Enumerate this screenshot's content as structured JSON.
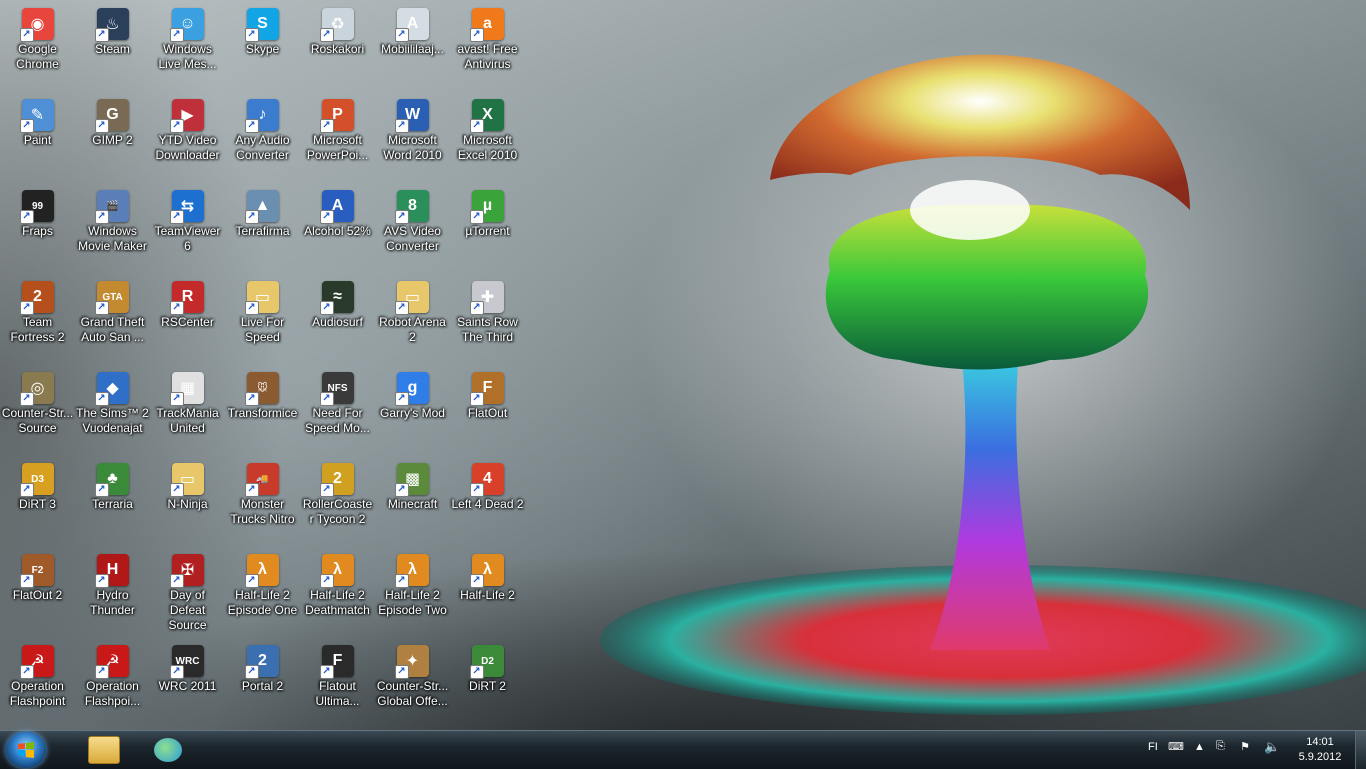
{
  "desktop_icons": [
    {
      "label": "Google Chrome",
      "icon": "chrome-icon",
      "color": "#e8453c",
      "glyph": "◉"
    },
    {
      "label": "Steam",
      "icon": "steam-icon",
      "color": "#2a3f5a",
      "glyph": "♨"
    },
    {
      "label": "Windows Live Mes...",
      "icon": "messenger-icon",
      "color": "#3aa0e0",
      "glyph": "☺"
    },
    {
      "label": "Skype",
      "icon": "skype-icon",
      "color": "#12a5e6",
      "glyph": "S"
    },
    {
      "label": "Roskakori",
      "icon": "recycle-bin-icon",
      "color": "#c9d4dc",
      "glyph": "♻"
    },
    {
      "label": "Mobiililaaj...",
      "icon": "mobile-broadband-icon",
      "color": "#d5dde4",
      "glyph": "A"
    },
    {
      "label": "avast! Free Antivirus",
      "icon": "avast-icon",
      "color": "#f07a1a",
      "glyph": "a"
    },
    {
      "label": "Paint",
      "icon": "paint-icon",
      "color": "#4e8fd6",
      "glyph": "✎"
    },
    {
      "label": "GIMP 2",
      "icon": "gimp-icon",
      "color": "#7b6a53",
      "glyph": "G"
    },
    {
      "label": "YTD Video Downloader",
      "icon": "ytd-icon",
      "color": "#c0303a",
      "glyph": "▶"
    },
    {
      "label": "Any Audio Converter",
      "icon": "audio-converter-icon",
      "color": "#3b7ccf",
      "glyph": "♪"
    },
    {
      "label": "Microsoft PowerPoi...",
      "icon": "powerpoint-icon",
      "color": "#d4502a",
      "glyph": "P"
    },
    {
      "label": "Microsoft Word 2010",
      "icon": "word-icon",
      "color": "#2b5fb4",
      "glyph": "W"
    },
    {
      "label": "Microsoft Excel 2010",
      "icon": "excel-icon",
      "color": "#217346",
      "glyph": "X"
    },
    {
      "label": "Fraps",
      "icon": "fraps-icon",
      "color": "#222222",
      "glyph": "99"
    },
    {
      "label": "Windows Movie Maker",
      "icon": "movie-maker-icon",
      "color": "#5a7fb8",
      "glyph": "🎬"
    },
    {
      "label": "TeamViewer 6",
      "icon": "teamviewer-icon",
      "color": "#1d6fd0",
      "glyph": "⇆"
    },
    {
      "label": "Terrafirma",
      "icon": "terrafirma-icon",
      "color": "#6a8fb0",
      "glyph": "▲"
    },
    {
      "label": "Alcohol 52%",
      "icon": "alcohol-icon",
      "color": "#2a5dc0",
      "glyph": "A"
    },
    {
      "label": "AVS Video Converter",
      "icon": "avs-icon",
      "color": "#2a8f5a",
      "glyph": "8"
    },
    {
      "label": "µTorrent",
      "icon": "utorrent-icon",
      "color": "#3aa33a",
      "glyph": "µ"
    },
    {
      "label": "Team Fortress 2",
      "icon": "tf2-icon",
      "color": "#b5501c",
      "glyph": "2"
    },
    {
      "label": "Grand Theft Auto San ...",
      "icon": "gta-icon",
      "color": "#c48a30",
      "glyph": "GTA"
    },
    {
      "label": "RSCenter",
      "icon": "rscenter-icon",
      "color": "#c42a2a",
      "glyph": "R"
    },
    {
      "label": "Live For Speed",
      "icon": "folder-icon",
      "color": "#e8c66a",
      "glyph": "▭"
    },
    {
      "label": "Audiosurf",
      "icon": "audiosurf-icon",
      "color": "#2a3a2a",
      "glyph": "≈"
    },
    {
      "label": "Robot Arena 2",
      "icon": "folder-icon",
      "color": "#e8c66a",
      "glyph": "▭"
    },
    {
      "label": "Saints Row The Third",
      "icon": "saints-row-icon",
      "color": "#c8c8d0",
      "glyph": "✚"
    },
    {
      "label": "Counter-Str... Source",
      "icon": "cs-source-icon",
      "color": "#8a7a50",
      "glyph": "◎"
    },
    {
      "label": "The Sims™ 2 Vuodenajat",
      "icon": "sims-icon",
      "color": "#2f6fc8",
      "glyph": "◆"
    },
    {
      "label": "TrackMania United",
      "icon": "trackmania-icon",
      "color": "#e0e0e0",
      "glyph": "▦"
    },
    {
      "label": "Transformice",
      "icon": "transformice-icon",
      "color": "#8a5a30",
      "glyph": "🐭"
    },
    {
      "label": "Need For Speed Mo...",
      "icon": "nfs-icon",
      "color": "#3a3a3a",
      "glyph": "NFS"
    },
    {
      "label": "Garry's Mod",
      "icon": "garrys-mod-icon",
      "color": "#2f7ee8",
      "glyph": "g"
    },
    {
      "label": "FlatOut",
      "icon": "flatout-icon",
      "color": "#b0702a",
      "glyph": "F"
    },
    {
      "label": "DiRT 3",
      "icon": "dirt3-icon",
      "color": "#d8a020",
      "glyph": "D3"
    },
    {
      "label": "Terraria",
      "icon": "terraria-icon",
      "color": "#3a8a3a",
      "glyph": "♣"
    },
    {
      "label": "N-Ninja",
      "icon": "folder-icon",
      "color": "#e8c66a",
      "glyph": "▭"
    },
    {
      "label": "Monster Trucks Nitro",
      "icon": "monster-trucks-icon",
      "color": "#c83a2a",
      "glyph": "🚚"
    },
    {
      "label": "RollerCoaster Tycoon 2",
      "icon": "rollercoaster-icon",
      "color": "#d0a020",
      "glyph": "2"
    },
    {
      "label": "Minecraft",
      "icon": "minecraft-icon",
      "color": "#5a8a3a",
      "glyph": "▩"
    },
    {
      "label": "Left 4 Dead 2",
      "icon": "l4d2-icon",
      "color": "#d8402a",
      "glyph": "4"
    },
    {
      "label": "FlatOut 2",
      "icon": "flatout2-icon",
      "color": "#a05a2a",
      "glyph": "F2"
    },
    {
      "label": "Hydro Thunder",
      "icon": "hydro-thunder-icon",
      "color": "#b01818",
      "glyph": "H"
    },
    {
      "label": "Day of Defeat Source",
      "icon": "dod-icon",
      "color": "#b02020",
      "glyph": "✠"
    },
    {
      "label": "Half-Life 2 Episode One",
      "icon": "hl2-icon",
      "color": "#e08a20",
      "glyph": "λ"
    },
    {
      "label": "Half-Life 2 Deathmatch",
      "icon": "hl2-icon",
      "color": "#e08a20",
      "glyph": "λ"
    },
    {
      "label": "Half-Life 2 Episode Two",
      "icon": "hl2-icon",
      "color": "#e08a20",
      "glyph": "λ"
    },
    {
      "label": "Half-Life 2",
      "icon": "hl2-icon",
      "color": "#e08a20",
      "glyph": "λ"
    },
    {
      "label": "Operation Flashpoint",
      "icon": "ofp-icon",
      "color": "#c81818",
      "glyph": "☭"
    },
    {
      "label": "Operation Flashpoi...",
      "icon": "ofp-icon",
      "color": "#c81818",
      "glyph": "☭"
    },
    {
      "label": "WRC 2011",
      "icon": "wrc-icon",
      "color": "#2a2a2a",
      "glyph": "WRC"
    },
    {
      "label": "Portal 2",
      "icon": "portal2-icon",
      "color": "#3a6fb0",
      "glyph": "2"
    },
    {
      "label": "Flatout Ultima...",
      "icon": "flatout-ultimate-icon",
      "color": "#2a2a2a",
      "glyph": "F"
    },
    {
      "label": "Counter-Str... Global Offe...",
      "icon": "csgo-icon",
      "color": "#b08040",
      "glyph": "✦"
    },
    {
      "label": "DiRT 2",
      "icon": "dirt2-icon",
      "color": "#3a8a3a",
      "glyph": "D2"
    }
  ],
  "taskbar": {
    "start_icon": "windows-start-icon",
    "pinned": [
      {
        "name": "explorer",
        "icon": "folder-icon",
        "color": "#e8c66a"
      },
      {
        "name": "messenger",
        "icon": "messenger-icon",
        "color": "#3aa0e0"
      }
    ],
    "language": "FI",
    "clock_time": "14:01",
    "clock_date": "5.9.2012"
  }
}
